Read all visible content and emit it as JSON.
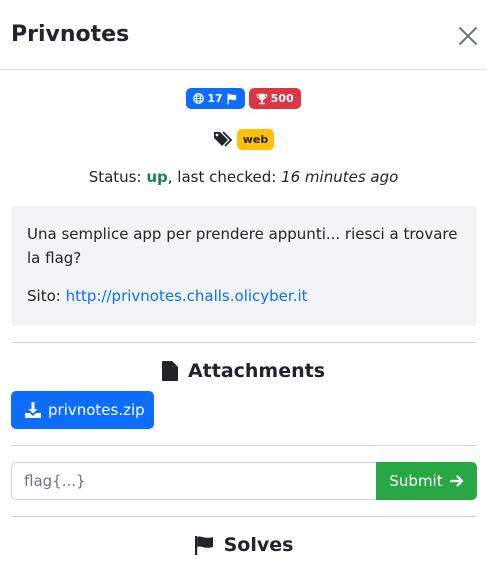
{
  "modal": {
    "title": "Privnotes"
  },
  "badges": {
    "solves_count": "17",
    "points": "500"
  },
  "tags": [
    "web"
  ],
  "status": {
    "label": "Status:",
    "value": "up",
    "checked_label": ", last checked:",
    "checked_time": "16 minutes ago"
  },
  "description": {
    "text": "Una semplice app per prendere appunti... riesci a trovare la flag?",
    "site_label": "Sito:",
    "site_url": "http://privnotes.challs.olicyber.it"
  },
  "attachments": {
    "title": "Attachments",
    "files": [
      "privnotes.zip"
    ]
  },
  "flag_form": {
    "placeholder": "flag{...}",
    "submit_label": "Submit"
  },
  "solves": {
    "title": "Solves"
  },
  "colors": {
    "primary": "#0d6efd",
    "danger": "#dc3545",
    "warning": "#ffc107",
    "success": "#28a745",
    "status_up": "#198754"
  }
}
